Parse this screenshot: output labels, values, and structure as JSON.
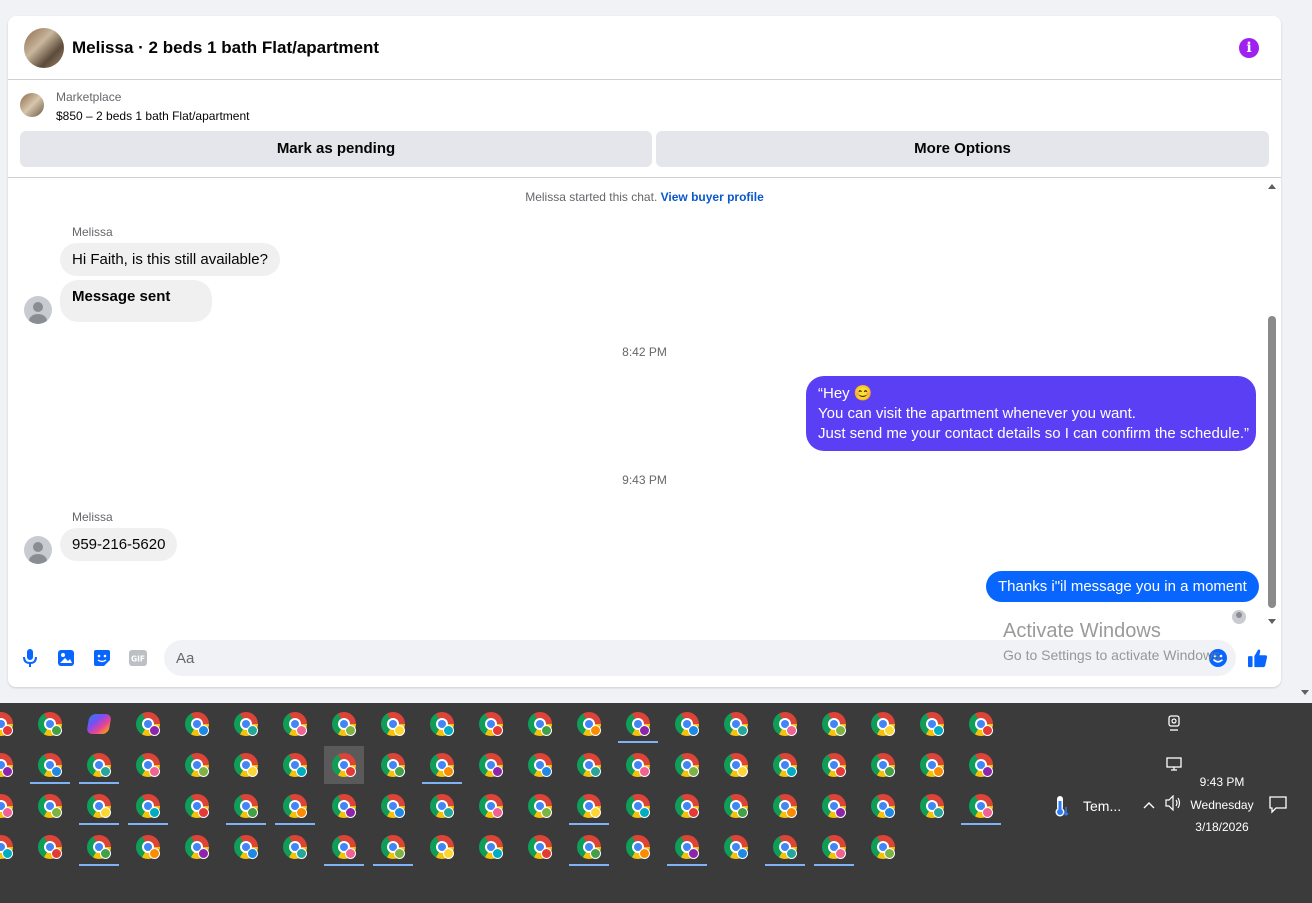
{
  "header": {
    "title": "Melissa · 2 beds 1 bath Flat/apartment",
    "info_icon": "info-icon",
    "accent": "#a020f0"
  },
  "listing": {
    "label": "Marketplace",
    "price_title": "$850 – 2 beds 1 bath Flat/apartment"
  },
  "actions": {
    "pending": "Mark as pending",
    "more": "More Options"
  },
  "system_note": {
    "text": "Melissa started this chat.",
    "link": "View buyer profile"
  },
  "messages": [
    {
      "sender": "Melissa",
      "text": "Hi Faith, is this still available?"
    },
    {
      "text": "Message sent"
    },
    {
      "timestamp": "8:42 PM"
    },
    {
      "outgoing": true,
      "lines": [
        "“Hey 😊",
        "You can visit the apartment whenever you want.",
        "Just send me your contact details so I can confirm the schedule.”"
      ]
    },
    {
      "timestamp": "9:43 PM"
    },
    {
      "sender": "Melissa",
      "text": "959-216-5620"
    },
    {
      "outgoing": true,
      "text": "Thanks i\"il message you in a moment"
    }
  ],
  "composer": {
    "placeholder": "Aa"
  },
  "watermark": {
    "title": "Activate Windows",
    "subtitle": "Go to Settings to activate Windows."
  },
  "colors": {
    "outgoing_purple": "#5b3ff5",
    "outgoing_blue": "#0866ff",
    "messenger_blue": "#0866ff"
  },
  "taskbar": {
    "weather_label": "Tem...",
    "clock": {
      "time": "9:43 PM",
      "day": "Wednesday",
      "date": "3/18/2026"
    }
  }
}
